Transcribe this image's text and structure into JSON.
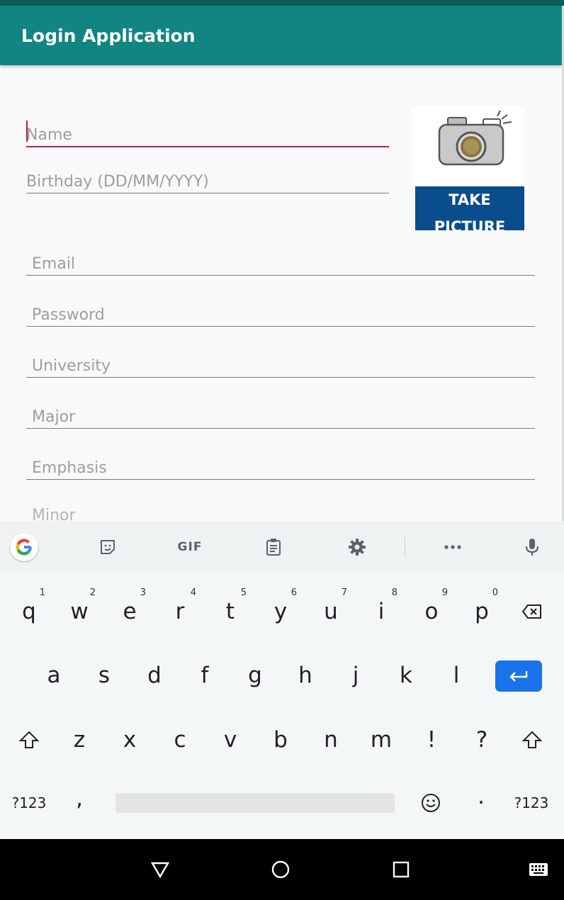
{
  "app": {
    "title": "Login Application"
  },
  "form": {
    "name_placeholder": "Name",
    "birthday_placeholder": "Birthday (DD/MM/YYYY)",
    "email_placeholder": "Email",
    "password_placeholder": "Password",
    "university_placeholder": "University",
    "major_placeholder": "Major",
    "emphasis_placeholder": "Emphasis",
    "minor_placeholder": "Minor"
  },
  "photo": {
    "button_label": "TAKE PICTURE",
    "icon": "camera-icon"
  },
  "keyboard": {
    "toolbar": {
      "gif_label": "GIF"
    },
    "row1": [
      {
        "k": "q",
        "h": "1"
      },
      {
        "k": "w",
        "h": "2"
      },
      {
        "k": "e",
        "h": "3"
      },
      {
        "k": "r",
        "h": "4"
      },
      {
        "k": "t",
        "h": "5"
      },
      {
        "k": "y",
        "h": "6"
      },
      {
        "k": "u",
        "h": "7"
      },
      {
        "k": "i",
        "h": "8"
      },
      {
        "k": "o",
        "h": "9"
      },
      {
        "k": "p",
        "h": "0"
      }
    ],
    "row2": [
      "a",
      "s",
      "d",
      "f",
      "g",
      "h",
      "j",
      "k",
      "l"
    ],
    "row3": [
      "z",
      "x",
      "c",
      "v",
      "b",
      "n",
      "m",
      "!",
      "?"
    ],
    "row4": {
      "symbols_left": "?123",
      "comma": ",",
      "period": "·",
      "symbols_right": "?123"
    }
  },
  "colors": {
    "appbar": "#128582",
    "accent": "#c2185b",
    "banner": "#0a4d8c",
    "enter": "#1a73e8"
  }
}
